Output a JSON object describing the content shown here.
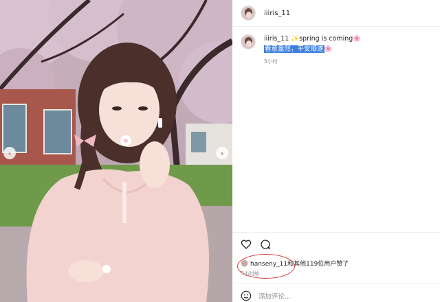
{
  "photo": {
    "alt_icon": "photo",
    "prev_icon": "chevron-left-icon",
    "next_icon": "chevron-right-icon"
  },
  "header": {
    "username": "iiiris_11"
  },
  "caption": {
    "username": "iiiris_11",
    "text": "✨spring is coming🌸",
    "line2": "春意盎然，平安顺遂",
    "line2_suffix": "🌸",
    "time": "5小时"
  },
  "actions": {
    "like_icon": "heart-icon",
    "comment_icon": "comment-icon"
  },
  "likes": {
    "text": "hanseny_11和其他119位用户赞了",
    "time": "5小时前"
  },
  "comment": {
    "placeholder": "添加评论..."
  },
  "colors": {
    "highlight": "#3d7fe0",
    "annotation": "#d23a3a",
    "muted": "#8e8e8e"
  }
}
